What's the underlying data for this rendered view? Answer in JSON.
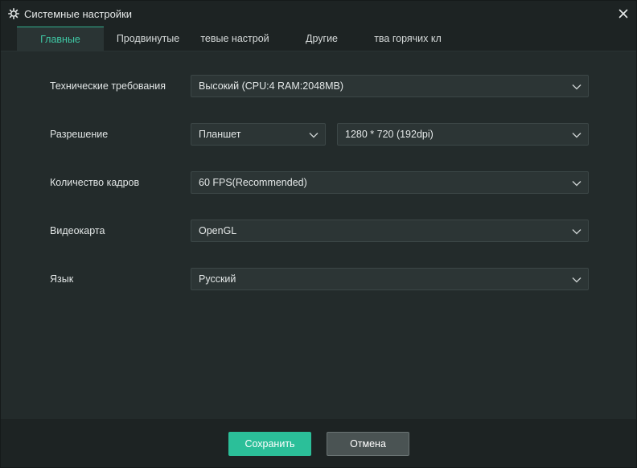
{
  "window": {
    "title": "Системные настройки",
    "icons": {
      "title": "gear-icon",
      "close": "close-icon",
      "dropdown": "chevron-down-icon"
    }
  },
  "tabs": [
    {
      "label": "Главные",
      "active": true
    },
    {
      "label": "Продвинутые",
      "active": false
    },
    {
      "label": "тевые настрой",
      "active": false
    },
    {
      "label": "Другие",
      "active": false
    },
    {
      "label": "тва горячих кл",
      "active": false
    }
  ],
  "settings": {
    "performance": {
      "label": "Технические требования",
      "value": "Высокий (CPU:4 RAM:2048MB)"
    },
    "resolution": {
      "label": "Разрешение",
      "device_value": "Планшет",
      "size_value": "1280 * 720 (192dpi)"
    },
    "fps": {
      "label": "Количество кадров",
      "value": "60 FPS(Recommended)"
    },
    "graphics": {
      "label": "Видеокарта",
      "value": "OpenGL"
    },
    "language": {
      "label": "Язык",
      "value": "Русский"
    }
  },
  "footer": {
    "save_label": "Сохранить",
    "cancel_label": "Отмена"
  },
  "colors": {
    "accent": "#2bbf99",
    "active_tab_text": "#3fc9a5",
    "background": "#232b2b",
    "titlebar": "#1d2323"
  }
}
